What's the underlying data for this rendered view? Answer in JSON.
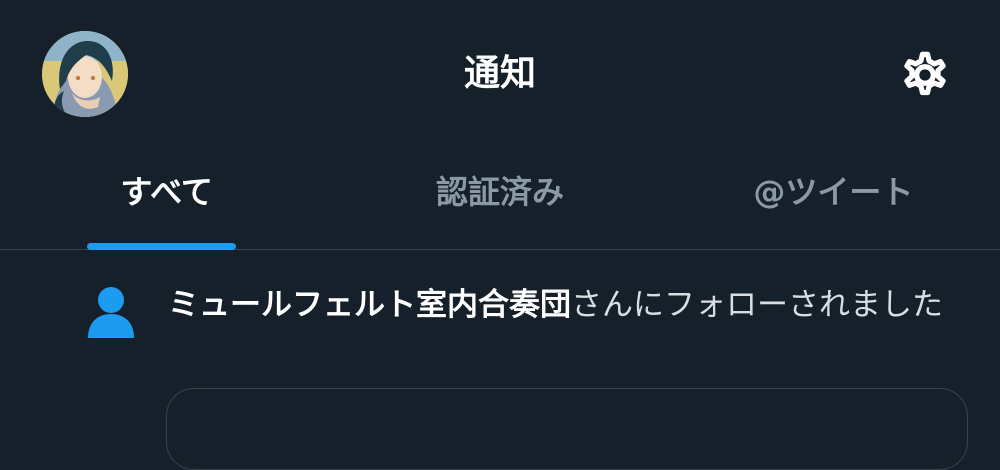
{
  "header": {
    "title": "通知",
    "avatar_icon": "profile-avatar",
    "settings_icon": "gear-icon"
  },
  "tabs": [
    {
      "label": "すべて",
      "active": true
    },
    {
      "label": "認証済み",
      "active": false
    },
    {
      "label": "@ツイート",
      "active": false
    }
  ],
  "notification": {
    "icon": "person-icon",
    "account_name": "ミュールフェルト室内合奏団",
    "message": "さんにフォローされました"
  },
  "colors": {
    "background": "#15202b",
    "accent": "#1d9bf0",
    "muted_text": "#8b98a5",
    "divider": "#38444d"
  }
}
